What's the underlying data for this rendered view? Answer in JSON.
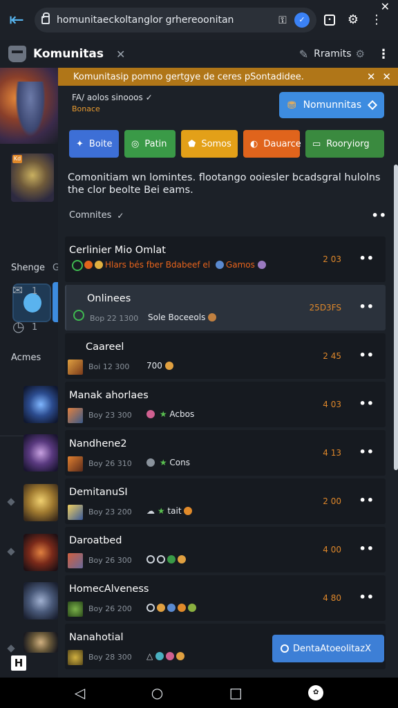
{
  "browser": {
    "url": "homunitaeckoltanglor grhereoonitan",
    "close_glyph": "✕"
  },
  "app_header": {
    "title": "Komunitas",
    "close_glyph": "✕",
    "user_name": "Rramits"
  },
  "sidebar": {
    "badge": "Kd",
    "label_shenge": "Shenge",
    "label_g": "G",
    "count_1": "1",
    "count_2": "1",
    "label_acmes": "Acmes"
  },
  "notice": {
    "text": "Komunitasip pomno gertgye de ceres pSontadidee."
  },
  "region": {
    "name": "FA/ aolos sinooos ✓",
    "sub": "Bonace"
  },
  "community_button": {
    "label": "Nomunnitas"
  },
  "filters": [
    {
      "label": "Boite",
      "color": "#3d6fd6",
      "icon": "✦"
    },
    {
      "label": "Patin",
      "color": "#3a9a47",
      "icon": "◎"
    },
    {
      "label": "Somos",
      "color": "#e3a018",
      "icon": "⬟"
    },
    {
      "label": "Dauarce",
      "color": "#e0641c",
      "icon": "◐"
    },
    {
      "label": "Rooryiorg",
      "color": "#3a8a3f",
      "icon": "▭"
    }
  ],
  "description": "Comonitiam wn lomintes. flootango ooiesler bcadsgral hulolns the clor beolte Bei eams.",
  "sort": {
    "label": "Comnites",
    "check": "✓",
    "more": "••"
  },
  "items": [
    {
      "title": "Cerlinier Mio Omlat",
      "meta": "",
      "tags": "Hlars bés fber Bdabeef el",
      "tags_suffix": "Gamos",
      "count": "2 03"
    },
    {
      "title": "Onlinees",
      "meta": "Bop 22 1300",
      "tags": "Sole Boceeols",
      "count": "25D3FS"
    },
    {
      "title": "Caareel",
      "meta": "Boi 12 300",
      "tags": "700",
      "count": "2 45"
    },
    {
      "title": "Manak ahorlaes",
      "meta": "Boy 23 300",
      "tags": "Acbos",
      "count": "4 03"
    },
    {
      "title": "Nandhene2",
      "meta": "Boy 26 310",
      "tags": "Cons",
      "count": "4 13"
    },
    {
      "title": "DemitanuSI",
      "meta": "Boy 23 200",
      "tags": "tait",
      "count": "2 00"
    },
    {
      "title": "Daroatbed",
      "meta": "Boy 26 300",
      "tags": "",
      "count": "4 00"
    },
    {
      "title": "HomecAlveness",
      "meta": "Boy 26 200",
      "tags": "",
      "count": "4 80"
    },
    {
      "title": "Nanahotial",
      "meta": "Boy 28 300",
      "tags": "",
      "count": ""
    }
  ],
  "join_button": {
    "label": "DentaAtoeolitazX"
  },
  "colors": {
    "accent": "#3d8ce0",
    "notice": "#b07618",
    "count": "#e0882a"
  }
}
